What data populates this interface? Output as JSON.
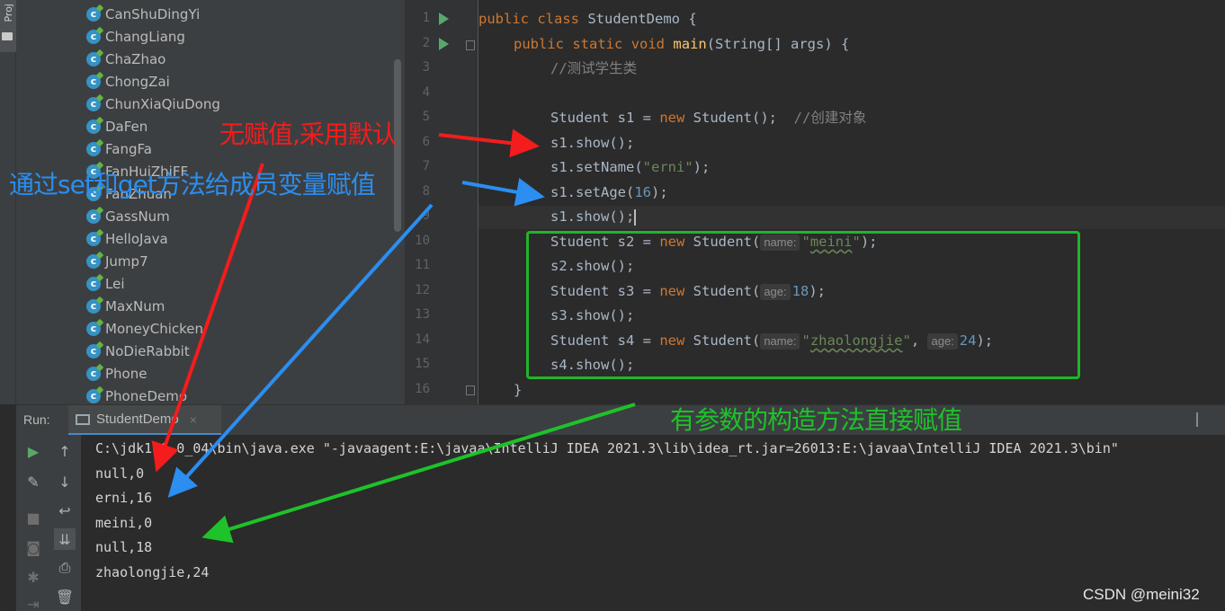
{
  "toolstrip": {
    "project_tab_label": "Proj"
  },
  "project_tree": {
    "items": [
      "CanShuDingYi",
      "ChangLiang",
      "ChaZhao",
      "ChongZai",
      "ChunXiaQiuDong",
      "DaFen",
      "FangFa",
      "FanHuiZhiFF",
      "FanZhuan",
      "GassNum",
      "HelloJava",
      "Jump7",
      "Lei",
      "MaxNum",
      "MoneyChicken",
      "NoDieRabbit",
      "Phone",
      "PhoneDemo"
    ],
    "icon_letter": "c"
  },
  "editor": {
    "line_numbers": [
      "1",
      "2",
      "3",
      "4",
      "5",
      "6",
      "7",
      "8",
      "9",
      "10",
      "11",
      "12",
      "13",
      "14",
      "15",
      "16"
    ],
    "l1": {
      "kw1": "public",
      "kw2": "class",
      "rest": " StudentDemo {"
    },
    "l2": {
      "kw1": "public",
      "kw2": "static",
      "kw3": "void",
      "fn": "main",
      "rest": "(String[] args) {"
    },
    "l3": {
      "comment": "//测试学生类"
    },
    "l5": {
      "pre": "Student s1 = ",
      "kw": "new",
      "post": " Student();  ",
      "comment": "//创建对象"
    },
    "l6": {
      "text": "s1.show();"
    },
    "l7": {
      "pre": "s1.setName(",
      "str": "\"erni\"",
      "post": ");"
    },
    "l8": {
      "pre": "s1.setAge(",
      "num": "16",
      "post": ");"
    },
    "l9": {
      "text": "s1.show();"
    },
    "l10": {
      "pre": "Student s2 = ",
      "kw": "new",
      "mid": " Student(",
      "hint": "name:",
      "str_q1": "\"",
      "str_mid": "meini",
      "str_q2": "\"",
      "post": ");"
    },
    "l11": {
      "text": "s2.show();"
    },
    "l12": {
      "pre": "Student s3 = ",
      "kw": "new",
      "mid": " Student(",
      "hint": "age:",
      "num": "18",
      "post": ");"
    },
    "l13": {
      "text": "s3.show();"
    },
    "l14": {
      "pre": "Student s4 = ",
      "kw": "new",
      "mid": " Student(",
      "hint1": "name:",
      "str_q1": "\"",
      "str_mid": "zhaolongjie",
      "str_q2": "\"",
      "comma": ", ",
      "hint2": "age:",
      "num": "24",
      "post": ");"
    },
    "l15": {
      "text": "s4.show();"
    },
    "l16": {
      "text": "}"
    }
  },
  "run_panel": {
    "label": "Run:",
    "tab_label": "StudentDemo",
    "tab_close": "×"
  },
  "console": {
    "lines": [
      "C:\\jdk1.6.0_04\\bin\\java.exe \"-javaagent:E:\\javaa\\IntelliJ IDEA 2021.3\\lib\\idea_rt.jar=26013:E:\\javaa\\IntelliJ IDEA 2021.3\\bin\"",
      "null,0",
      "erni,16",
      "meini,0",
      "null,18",
      "zhaolongjie,24"
    ]
  },
  "annotations": {
    "red": "无赋值,采用默认",
    "blue": "通过set和get方法给成员变量赋值",
    "green": "有参数的构造方法直接赋值"
  },
  "colors": {
    "red": "#f41c1c",
    "blue": "#2b8ef0",
    "green": "#1ec22a",
    "keyword": "#cc7832",
    "string": "#6a8759",
    "number": "#6897bb"
  },
  "watermark": "CSDN @meini32"
}
